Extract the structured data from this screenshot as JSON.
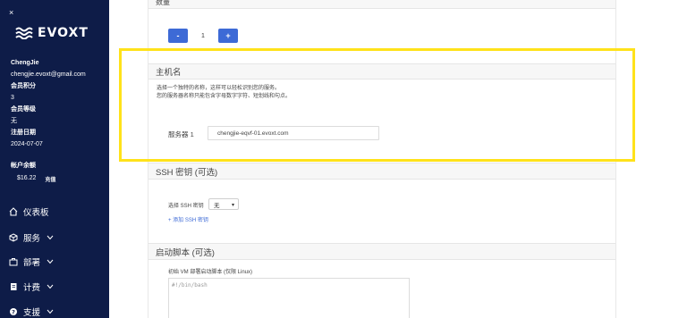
{
  "sidebar": {
    "close_symbol": "×",
    "logo_text": "EVOXT",
    "user_name": "ChengJie",
    "email": "chengjie.evoxt@gmail.com",
    "points_label": "会员积分",
    "points_value": "3",
    "level_label": "会员等级",
    "level_value": "无",
    "reg_label": "注册日期",
    "reg_value": "2024-07-07",
    "balance_label": "帐户余额",
    "balance_value": "$16.22",
    "balance_badge": "充值",
    "nav": [
      {
        "label": "仪表板",
        "icon": "home-icon"
      },
      {
        "label": "服务",
        "icon": "box-icon"
      },
      {
        "label": "部署",
        "icon": "briefcase-icon"
      },
      {
        "label": "计费",
        "icon": "file-icon"
      },
      {
        "label": "支援",
        "icon": "help-icon"
      }
    ]
  },
  "main": {
    "quantity_label": "数量",
    "quantity": {
      "minus": "-",
      "value": "1",
      "plus": "+"
    },
    "hostname": {
      "title": "主机名",
      "desc_line1": "选择一个独特的名称，这样可以轻松识别您的服务。",
      "desc_line2": "您的服务器名称只能包含字母数字字符、短划线和句点。",
      "server_label": "服务器 1",
      "server_value": "chengjie-eqvf-01.evoxt.com"
    },
    "ssh": {
      "title": "SSH 密钥 (可选)",
      "select_label": "选择 SSH 密钥",
      "select_value": "无",
      "add_link": "+ 添加 SSH 密钥"
    },
    "startup": {
      "title": "启动脚本 (可选)",
      "label": "初始 VM 部署启动脚本 (仅限 Linux)",
      "placeholder": "#!/bin/bash"
    }
  },
  "colors": {
    "sidebar_bg": "#0e1c48",
    "accent": "#3d6ad6",
    "highlight": "#ffe21a"
  }
}
